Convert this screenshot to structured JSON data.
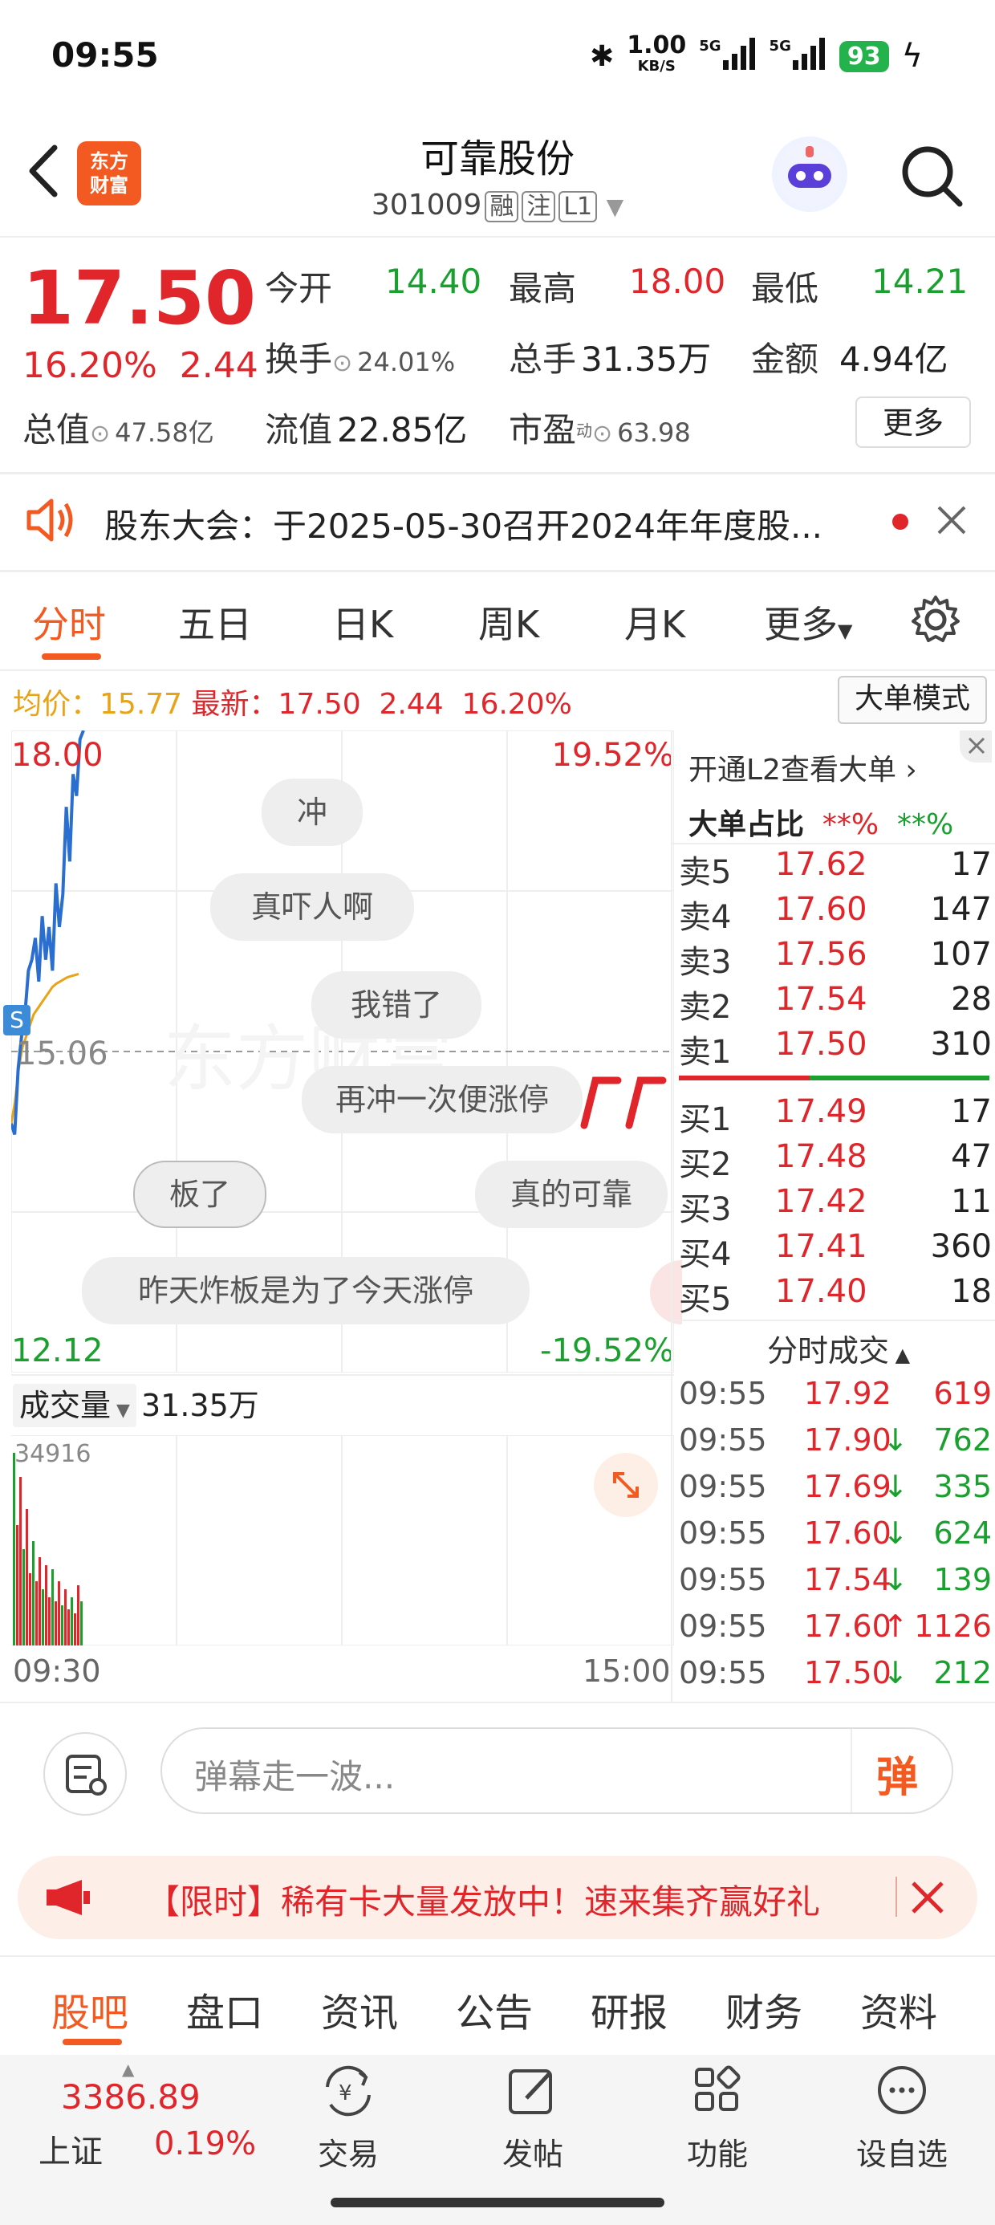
{
  "status": {
    "time": "09:55",
    "speed": "1.00",
    "speed_unit": "KB/S",
    "net1": "5G",
    "net2": "5G",
    "battery": "93"
  },
  "header": {
    "logo": "东方\n财富",
    "title": "可靠股份",
    "code": "301009",
    "tags": [
      "融",
      "注",
      "L1"
    ]
  },
  "quote": {
    "price": "17.50",
    "change_pct": "16.20%",
    "change": "2.44",
    "items": [
      {
        "label": "今开",
        "value": "14.40",
        "color": "green"
      },
      {
        "label": "最高",
        "value": "18.00",
        "color": "red"
      },
      {
        "label": "最低",
        "value": "14.21",
        "color": "green"
      },
      {
        "label": "换手",
        "value": "24.01%",
        "color": "gray"
      },
      {
        "label": "总手",
        "value": "31.35万",
        "color": "gray"
      },
      {
        "label": "金额",
        "value": "4.94亿",
        "color": "gray"
      },
      {
        "label": "总值",
        "value": "47.58亿",
        "color": "gray"
      },
      {
        "label": "流值",
        "value": "22.85亿",
        "color": "gray"
      },
      {
        "label": "市盈",
        "value": "63.98",
        "color": "gray"
      }
    ],
    "more_label": "更多"
  },
  "notice": {
    "text": "股东大会：于2025-05-30召开2024年年度股..."
  },
  "tabs": [
    "分时",
    "五日",
    "日K",
    "周K",
    "月K",
    "更多"
  ],
  "info": {
    "avg_label": "均价：",
    "avg": "15.77",
    "latest_label": "最新：",
    "latest": "17.50",
    "chg": "2.44",
    "pct": "16.20%",
    "big_mode": "大单模式"
  },
  "chart": {
    "top_price": "18.00",
    "top_pct": "19.52%",
    "mid_price": "15.06",
    "bottom_price": "12.12",
    "bottom_pct": "-19.52%",
    "bubbles": [
      "冲",
      "真吓人啊",
      "我错了",
      "再冲一次便涨停",
      "板了",
      "真的可靠",
      "昨天炸板是为了今天涨停"
    ],
    "watermark": "东方财富",
    "s_marker": "S"
  },
  "chart_data": {
    "type": "line",
    "title": "",
    "ylim": [
      12.12,
      18.0
    ],
    "series": [
      {
        "values": [
          14.4,
          14.3,
          14.9,
          15.2,
          15.4,
          15.8,
          15.9,
          16.1,
          15.7,
          16.3,
          15.9,
          16.2,
          15.8,
          16.6,
          16.2,
          16.5,
          17.3,
          16.8,
          17.6,
          17.4,
          17.92,
          18.0
        ]
      },
      {
        "values": [
          14.4,
          14.6,
          14.9,
          15.1,
          15.2,
          15.3,
          15.4,
          15.45,
          15.5,
          15.55,
          15.6,
          15.65,
          15.68,
          15.7,
          15.72,
          15.74,
          15.75,
          15.76,
          15.77
        ]
      }
    ]
  },
  "orderbook": {
    "link": "开通L2查看大单",
    "ratio_label": "大单占比",
    "ratio_red": "**%",
    "ratio_green": "**%",
    "sells": [
      [
        "卖5",
        "17.62",
        "17"
      ],
      [
        "卖4",
        "17.60",
        "147"
      ],
      [
        "卖3",
        "17.56",
        "107"
      ],
      [
        "卖2",
        "17.54",
        "28"
      ],
      [
        "卖1",
        "17.50",
        "310"
      ]
    ],
    "buys": [
      [
        "买1",
        "17.49",
        "17"
      ],
      [
        "买2",
        "17.48",
        "47"
      ],
      [
        "买3",
        "17.42",
        "11"
      ],
      [
        "买4",
        "17.41",
        "360"
      ],
      [
        "买5",
        "17.40",
        "18"
      ]
    ]
  },
  "trades": {
    "title": "分时成交",
    "rows": [
      [
        "09:55",
        "17.92",
        "",
        "619",
        "red"
      ],
      [
        "09:55",
        "17.90",
        "↓",
        "762",
        "green"
      ],
      [
        "09:55",
        "17.69",
        "↓",
        "335",
        "green"
      ],
      [
        "09:55",
        "17.60",
        "↓",
        "624",
        "green"
      ],
      [
        "09:55",
        "17.54",
        "↓",
        "139",
        "green"
      ],
      [
        "09:55",
        "17.60",
        "↑",
        "1126",
        "red"
      ],
      [
        "09:55",
        "17.50",
        "↓",
        "212",
        "green"
      ]
    ]
  },
  "volume": {
    "label": "成交量",
    "total": "31.35万",
    "max": "34916",
    "start": "09:30",
    "end": "15:00"
  },
  "comment": {
    "placeholder": "弹幕走一波...",
    "send": "弹"
  },
  "promo": {
    "text": "【限时】稀有卡大量发放中！速来集齐赢好礼"
  },
  "bottom_tabs": [
    "股吧",
    "盘口",
    "资讯",
    "公告",
    "研报",
    "财务",
    "资料"
  ],
  "index": {
    "value": "3386.89",
    "name": "上证",
    "pct": "0.19%"
  },
  "nav": [
    "交易",
    "发帖",
    "功能",
    "设自选"
  ],
  "colors": {
    "accent": "#f25a22",
    "up": "#e0252b",
    "down": "#1aa02e"
  }
}
